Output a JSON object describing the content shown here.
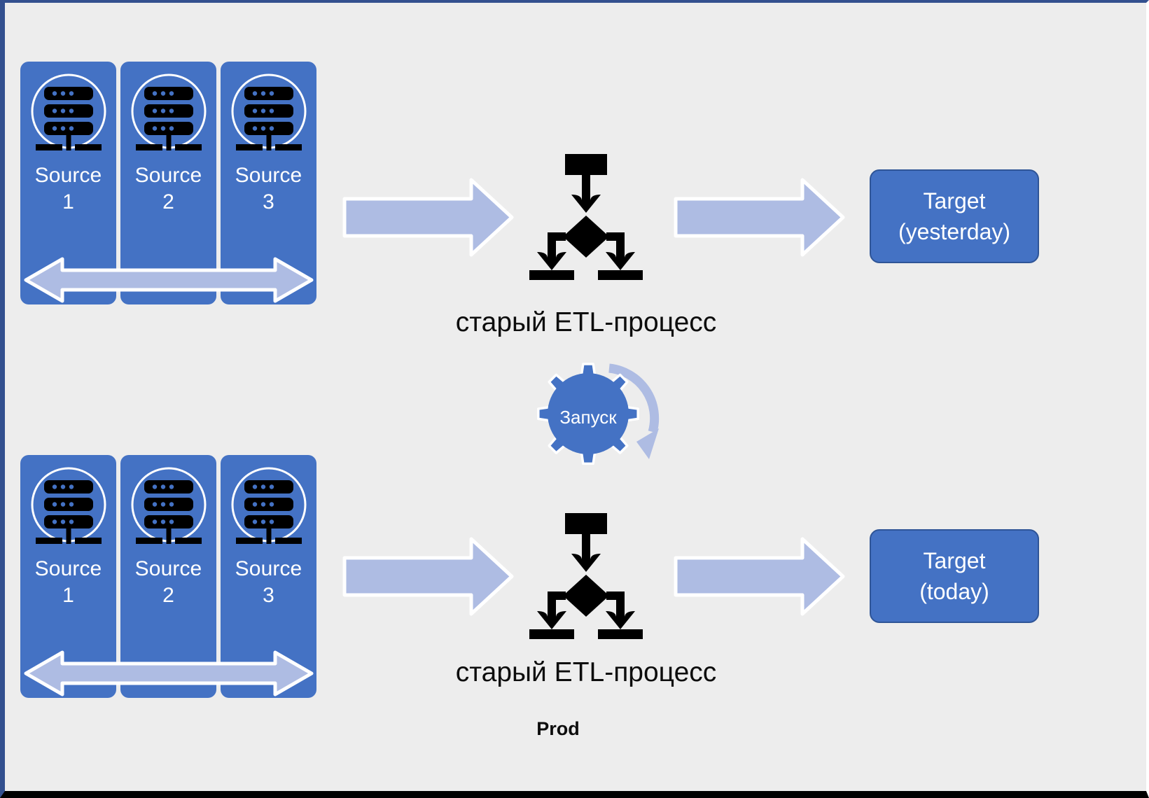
{
  "slide": {
    "background_color": "#ededed",
    "frame_color": "#33508f",
    "accent_blue": "#4472c4",
    "accent_light_blue": "#aebce3",
    "border_blue": "#2f5597",
    "text_dark": "#0d0d0d"
  },
  "rows": [
    {
      "id": "yesterday",
      "sources": [
        {
          "label": "Source\n1",
          "icon": "server-icon"
        },
        {
          "label": "Source\n2",
          "icon": "server-icon"
        },
        {
          "label": "Source\n3",
          "icon": "server-icon"
        }
      ],
      "span_arrow": "double-headed-arrow-icon",
      "arrow_in": "right-arrow-icon",
      "process_icon": "flowchart-icon",
      "process_caption": "старый ETL-процесс",
      "arrow_out": "right-arrow-icon",
      "target_label": "Target\n(yesterday)"
    },
    {
      "id": "today",
      "sources": [
        {
          "label": "Source\n1",
          "icon": "server-icon"
        },
        {
          "label": "Source\n2",
          "icon": "server-icon"
        },
        {
          "label": "Source\n3",
          "icon": "server-icon"
        }
      ],
      "span_arrow": "double-headed-arrow-icon",
      "arrow_in": "right-arrow-icon",
      "process_icon": "flowchart-icon",
      "process_caption": "старый ETL-процесс",
      "arrow_out": "right-arrow-icon",
      "target_label": "Target\n(today)"
    }
  ],
  "gear": {
    "label": "Запуск",
    "icon": "gear-icon",
    "rotate_arrow": "circular-arrow-icon"
  },
  "footer": {
    "label": "Prod"
  }
}
